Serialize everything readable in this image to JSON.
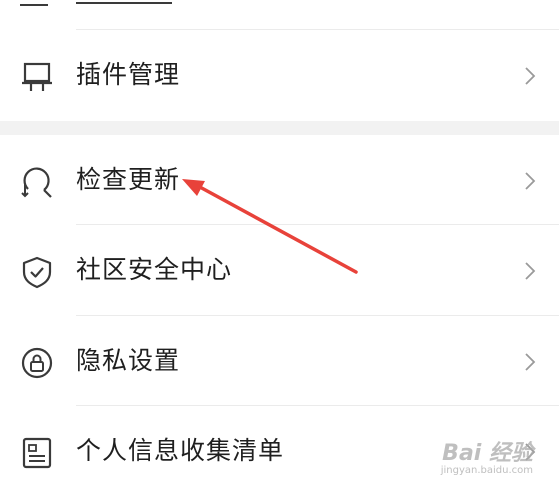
{
  "settings": {
    "items": [
      {
        "label": "插件管理",
        "icon": "plugin-icon"
      },
      {
        "label": "检查更新",
        "icon": "check-update-icon"
      },
      {
        "label": "社区安全中心",
        "icon": "shield-icon"
      },
      {
        "label": "隐私设置",
        "icon": "lock-icon"
      },
      {
        "label": "个人信息收集清单",
        "icon": "list-icon"
      }
    ]
  },
  "annotation": {
    "arrow_color": "#e8423a"
  },
  "watermark": {
    "brand": "Bai 经验",
    "url": "jingyan.baidu.com"
  }
}
